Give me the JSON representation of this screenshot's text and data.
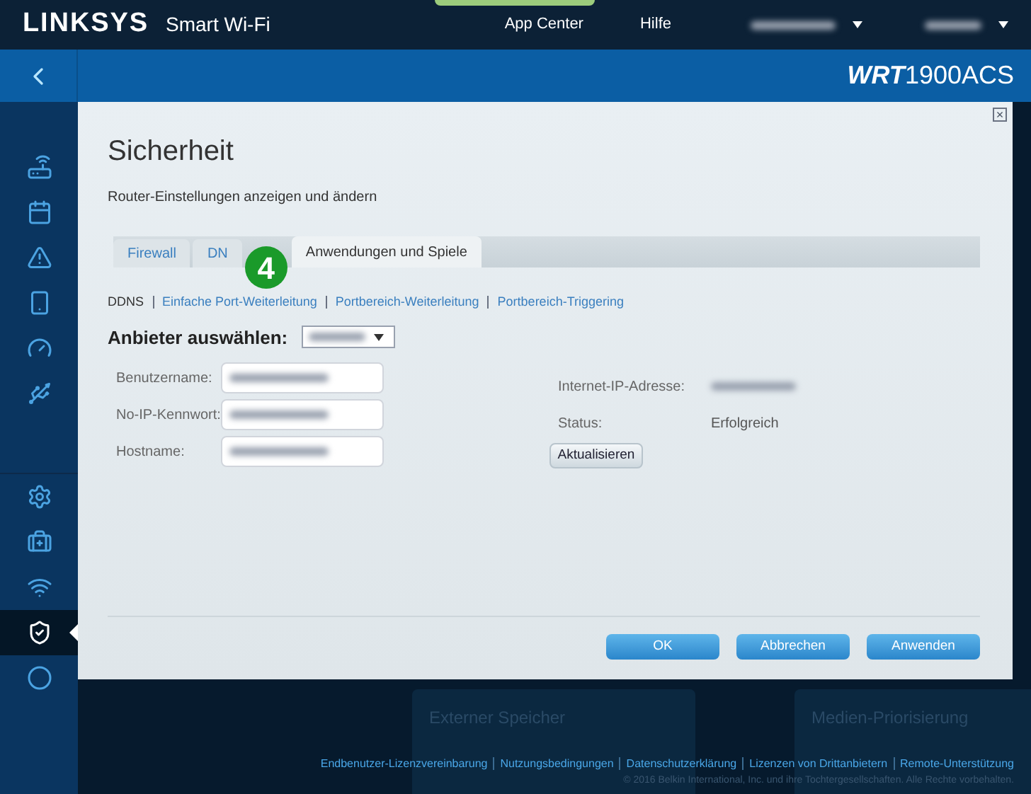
{
  "header": {
    "brand": "LINKSYS",
    "product": "Smart Wi-Fi",
    "menu": [
      "App Center",
      "Hilfe"
    ]
  },
  "subheader": {
    "model_prefix": "WRT",
    "model": "1900ACS"
  },
  "sidebar": {
    "groups": [
      [
        {
          "selected": false
        },
        {
          "selected": false
        },
        {
          "selected": false
        },
        {
          "selected": false
        },
        {
          "selected": false
        },
        {
          "selected": false
        }
      ],
      [
        {
          "selected": false
        },
        {
          "selected": false
        },
        {
          "selected": false
        },
        {
          "selected": true
        },
        {
          "selected": false
        }
      ]
    ]
  },
  "background_cards": [
    {
      "title": "Externer Speicher"
    },
    {
      "title": "Medien-Priorisierung"
    }
  ],
  "dialog": {
    "close": "×",
    "title": "Sicherheit",
    "subtitle": "Router-Einstellungen anzeigen und ändern",
    "tabs": [
      {
        "label": "Firewall",
        "selected": false
      },
      {
        "label": "DN",
        "selected": false
      },
      {
        "label": "Anwendungen und Spiele",
        "selected": true
      }
    ],
    "step_badge": "4",
    "subtabs": [
      {
        "label": "DDNS",
        "selected": true
      },
      {
        "label": "Einfache Port-Weiterleitung",
        "selected": false
      },
      {
        "label": "Portbereich-Weiterleitung",
        "selected": false
      },
      {
        "label": "Portbereich-Triggering",
        "selected": false
      }
    ],
    "provider_label": "Anbieter auswählen:",
    "fields": [
      {
        "label": "Benutzername:"
      },
      {
        "label": "No-IP-Kennwort:"
      },
      {
        "label": "Hostname:"
      }
    ],
    "info": [
      {
        "label": "Internet-IP-Adresse:"
      },
      {
        "label": "Status:",
        "value": "Erfolgreich"
      }
    ],
    "refresh_button": "Aktualisieren",
    "buttons": [
      "OK",
      "Abbrechen",
      "Anwenden"
    ]
  },
  "footer": {
    "links": [
      "Endbenutzer-Lizenzvereinbarung",
      "Nutzungsbedingungen",
      "Datenschutzerklärung",
      "Lizenzen von Drittanbietern",
      "Remote-Unterstützung"
    ],
    "copyright": "© 2016 Belkin International, Inc. und ihre Tochtergesellschaften. Alle Rechte vorbehalten."
  }
}
